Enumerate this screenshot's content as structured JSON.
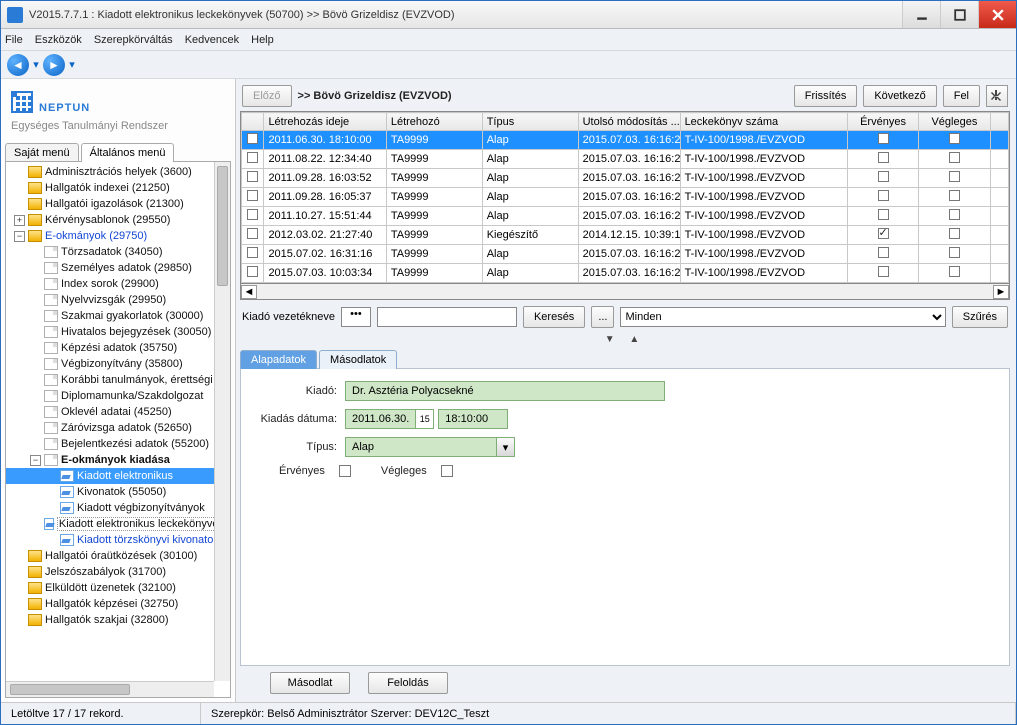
{
  "window": {
    "title": "V2015.7.7.1 : Kiadott elektronikus leckekönyvek (50700)  >> Bövö Grizeldisz (EVZVOD)"
  },
  "menubar": [
    "File",
    "Eszközök",
    "Szerepkörváltás",
    "Kedvencek",
    "Help"
  ],
  "logo": {
    "main": "NEPTUN",
    "sub": "Egységes Tanulmányi Rendszer"
  },
  "side_tabs": {
    "inactive": "Saját menü",
    "active": "Általános menü"
  },
  "tree": [
    {
      "d": 1,
      "exp": " ",
      "icon": "folder",
      "label": "Adminisztrációs helyek (3600)",
      "top_arrow": "▲"
    },
    {
      "d": 1,
      "exp": " ",
      "icon": "folder",
      "label": "Hallgatók indexei (21250)"
    },
    {
      "d": 1,
      "exp": " ",
      "icon": "folder",
      "label": "Hallgatói igazolások (21300)"
    },
    {
      "d": 1,
      "exp": "+",
      "icon": "folder",
      "label": "Kérvénysablonok (29550)"
    },
    {
      "d": 1,
      "exp": "−",
      "icon": "folder",
      "label": "E-okmányok (29750)",
      "link": true
    },
    {
      "d": 2,
      "exp": " ",
      "icon": "page",
      "label": "Törzsadatok (34050)"
    },
    {
      "d": 2,
      "exp": " ",
      "icon": "page",
      "label": "Személyes adatok (29850)"
    },
    {
      "d": 2,
      "exp": " ",
      "icon": "page",
      "label": "Index sorok (29900)"
    },
    {
      "d": 2,
      "exp": " ",
      "icon": "page",
      "label": "Nyelvvizsgák (29950)"
    },
    {
      "d": 2,
      "exp": " ",
      "icon": "page",
      "label": "Szakmai gyakorlatok (30000)"
    },
    {
      "d": 2,
      "exp": " ",
      "icon": "page",
      "label": "Hivatalos bejegyzések (30050)"
    },
    {
      "d": 2,
      "exp": " ",
      "icon": "page",
      "label": "Képzési adatok (35750)"
    },
    {
      "d": 2,
      "exp": " ",
      "icon": "page",
      "label": "Végbizonyítvány (35800)"
    },
    {
      "d": 2,
      "exp": " ",
      "icon": "page",
      "label": "Korábbi tanulmányok, érettségi"
    },
    {
      "d": 2,
      "exp": " ",
      "icon": "page",
      "label": "Diplomamunka/Szakdolgozat"
    },
    {
      "d": 2,
      "exp": " ",
      "icon": "page",
      "label": "Oklevél adatai (45250)"
    },
    {
      "d": 2,
      "exp": " ",
      "icon": "page",
      "label": "Záróvizsga adatok (52650)"
    },
    {
      "d": 2,
      "exp": " ",
      "icon": "page",
      "label": "Bejelentkezési adatok (55200)"
    },
    {
      "d": 2,
      "exp": "−",
      "icon": "page",
      "label": "E-okmányok kiadása",
      "bold": true
    },
    {
      "d": 3,
      "exp": " ",
      "icon": "blue",
      "label": "Kiadott elektronikus",
      "link": true,
      "sel": true
    },
    {
      "d": 3,
      "exp": " ",
      "icon": "blue",
      "label": "Kivonatok (55050)"
    },
    {
      "d": 3,
      "exp": " ",
      "icon": "blue",
      "label": "Kiadott végbizonyítványok"
    },
    {
      "d": 3,
      "exp": " ",
      "icon": "blue",
      "label": "Kiadott elektronikus leckekönyvek",
      "box": true
    },
    {
      "d": 3,
      "exp": " ",
      "icon": "blue",
      "label": "Kiadott törzskönyvi kivonatok",
      "link": true
    },
    {
      "d": 1,
      "exp": " ",
      "icon": "folder",
      "label": "Hallgatói óraütközések (30100)"
    },
    {
      "d": 1,
      "exp": " ",
      "icon": "folder",
      "label": "Jelszószabályok (31700)"
    },
    {
      "d": 1,
      "exp": " ",
      "icon": "folder",
      "label": "Elküldött üzenetek (32100)"
    },
    {
      "d": 1,
      "exp": " ",
      "icon": "folder",
      "label": "Hallgatók képzései (32750)"
    },
    {
      "d": 1,
      "exp": " ",
      "icon": "folder",
      "label": "Hallgatók szakjai (32800)",
      "bottom_arrow": "▼"
    }
  ],
  "header": {
    "prev": "Előző",
    "crumb": ">> Bövö Grizeldisz (EVZVOD)",
    "refresh": "Frissítés",
    "next": "Következő",
    "up": "Fel"
  },
  "grid": {
    "cols": [
      "",
      "Létrehozás ideje",
      "Létrehozó",
      "Típus",
      "Utolsó módosítás ...",
      "Leckekönyv száma",
      "Érvényes",
      "Végleges"
    ],
    "rows": [
      {
        "sel": true,
        "c": [
          "2011.06.30. 18:10:00",
          "TA9999",
          "Alap",
          "2015.07.03. 16:16:2",
          "T-IV-100/1998./EVZVOD"
        ],
        "erv": false,
        "veg": false
      },
      {
        "c": [
          "2011.08.22. 12:34:40",
          "TA9999",
          "Alap",
          "2015.07.03. 16:16:2",
          "T-IV-100/1998./EVZVOD"
        ],
        "erv": false,
        "veg": false
      },
      {
        "c": [
          "2011.09.28. 16:03:52",
          "TA9999",
          "Alap",
          "2015.07.03. 16:16:2",
          "T-IV-100/1998./EVZVOD"
        ],
        "erv": false,
        "veg": false
      },
      {
        "c": [
          "2011.09.28. 16:05:37",
          "TA9999",
          "Alap",
          "2015.07.03. 16:16:2",
          "T-IV-100/1998./EVZVOD"
        ],
        "erv": false,
        "veg": false
      },
      {
        "c": [
          "2011.10.27. 15:51:44",
          "TA9999",
          "Alap",
          "2015.07.03. 16:16:2",
          "T-IV-100/1998./EVZVOD"
        ],
        "erv": false,
        "veg": false
      },
      {
        "c": [
          "2012.03.02. 21:27:40",
          "TA9999",
          "Kiegészítő",
          "2014.12.15. 10:39:1",
          "T-IV-100/1998./EVZVOD"
        ],
        "erv": true,
        "veg": false
      },
      {
        "c": [
          "2015.07.02. 16:31:16",
          "TA9999",
          "Alap",
          "2015.07.03. 16:16:2",
          "T-IV-100/1998./EVZVOD"
        ],
        "erv": false,
        "veg": false
      },
      {
        "c": [
          "2015.07.03. 10:03:34",
          "TA9999",
          "Alap",
          "2015.07.03. 16:16:2",
          "T-IV-100/1998./EVZVOD"
        ],
        "erv": false,
        "veg": false
      }
    ]
  },
  "search": {
    "label": "Kiadó vezetékneve",
    "btn_search": "Keresés",
    "btn_dots": "...",
    "combo": "Minden",
    "btn_filter": "Szűrés"
  },
  "det_tabs": {
    "active": "Alapadatok",
    "other": "Másodlatok"
  },
  "detail": {
    "kiado_lbl": "Kiadó:",
    "kiado_val": "Dr. Asztéria Polyacsekné",
    "datum_lbl": "Kiadás dátuma:",
    "datum_val": "2011.06.30.",
    "time_val": "18:10:00",
    "tipus_lbl": "Típus:",
    "tipus_val": "Alap",
    "erv_lbl": "Érvényes",
    "veg_lbl": "Végleges"
  },
  "bottom": {
    "masodlat": "Másodlat",
    "feloldas": "Feloldás"
  },
  "status": {
    "left": "Letöltve 17 / 17 rekord.",
    "mid": "Szerepkör: Belső Adminisztrátor   Szerver: DEV12C_Teszt"
  }
}
